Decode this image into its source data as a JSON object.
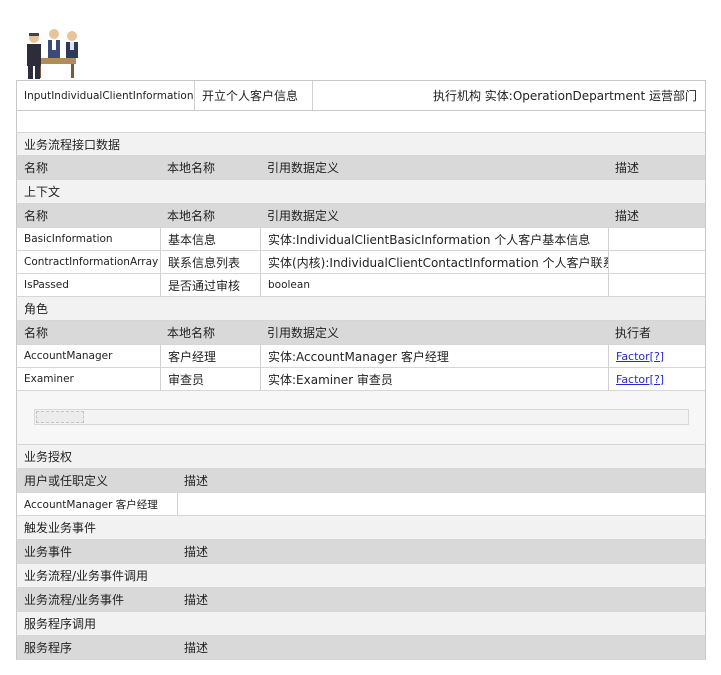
{
  "header": {
    "process_id": "InputIndividualClientInformation",
    "process_name": "开立个人客户信息",
    "executor": "执行机构 实体:OperationDepartment 运营部门"
  },
  "interface": {
    "title": "业务流程接口数据",
    "columns": [
      "名称",
      "本地名称",
      "引用数据定义",
      "描述"
    ]
  },
  "context": {
    "title": "上下文",
    "columns": [
      "名称",
      "本地名称",
      "引用数据定义",
      "描述"
    ],
    "rows": [
      {
        "name": "BasicInformation",
        "local": "基本信息",
        "ref": "实体:IndividualClientBasicInformation 个人客户基本信息"
      },
      {
        "name": "ContractInformationArray",
        "local": "联系信息列表",
        "ref": "实体(内核):IndividualClientContactInformation 个人客户联系信息"
      },
      {
        "name": "IsPassed",
        "local": "是否通过审核",
        "ref": "boolean"
      }
    ]
  },
  "roles": {
    "title": "角色",
    "columns": [
      "名称",
      "本地名称",
      "引用数据定义",
      "执行者"
    ],
    "rows": [
      {
        "name": "AccountManager",
        "local": "客户经理",
        "ref": "实体:AccountManager 客户经理",
        "executor": "Factor[?]"
      },
      {
        "name": "Examiner",
        "local": "审查员",
        "ref": "实体:Examiner 审查员",
        "executor": "Factor[?]"
      }
    ]
  },
  "authorization": {
    "title": "业务授权",
    "columns": [
      "用户或任职定义",
      "描述"
    ],
    "rows": [
      {
        "user": "AccountManager 客户经理",
        "desc": ""
      }
    ]
  },
  "trigger": {
    "title": "触发业务事件",
    "columns": [
      "业务事件",
      "描述"
    ]
  },
  "invocation": {
    "title": "业务流程/业务事件调用",
    "columns": [
      "业务流程/业务事件",
      "描述"
    ]
  },
  "service": {
    "title": "服务程序调用",
    "columns": [
      "服务程序",
      "描述"
    ]
  }
}
